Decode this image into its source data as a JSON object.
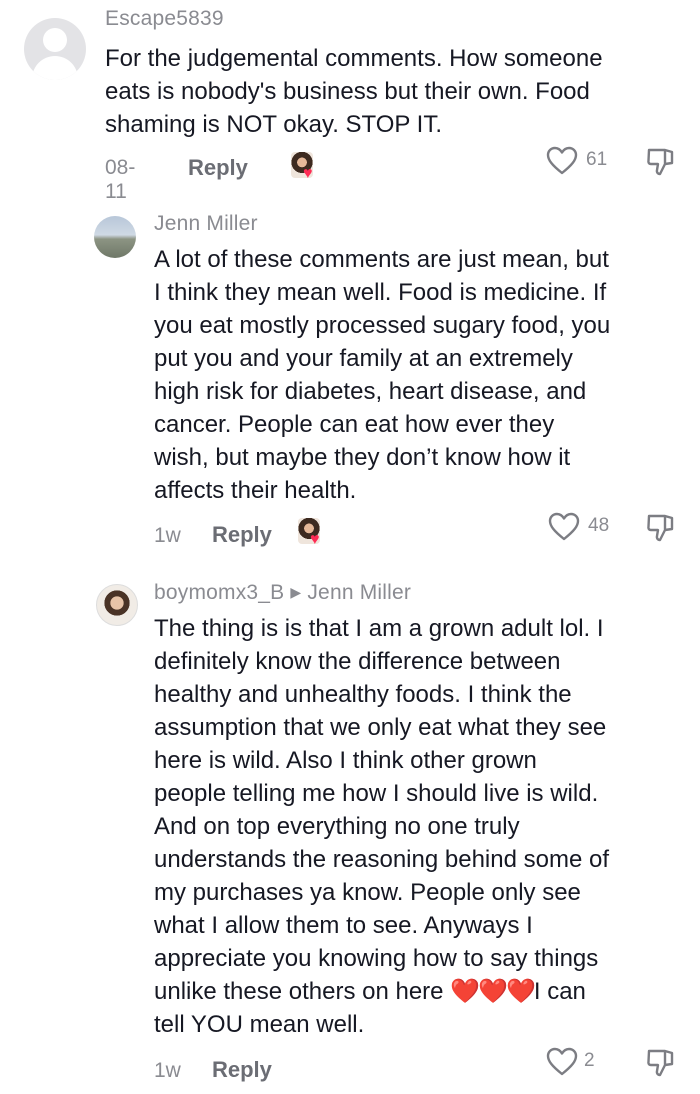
{
  "comments": [
    {
      "username": "Escape5839",
      "lines": [
        "For the judgemental comments. How someone",
        "eats is nobody's business but their own. Food",
        "shaming is NOT okay. STOP IT."
      ],
      "date": "08-11",
      "reply_label": "Reply",
      "likes": "61"
    },
    {
      "username": "Jenn Miller",
      "lines": [
        "A lot of these comments are just mean, but",
        "I think they mean well. Food is medicine. If",
        "you eat mostly processed sugary food, you",
        "put you and your family at an extremely",
        "high risk for diabetes, heart disease, and",
        "cancer. People can eat how ever they",
        "wish, but maybe they don’t know how it",
        "affects their health."
      ],
      "date": "1w",
      "reply_label": "Reply",
      "likes": "48"
    },
    {
      "username": "boymomx3_B",
      "reply_to": "Jenn Miller",
      "lines": [
        "The thing is is that I am a grown adult lol. I",
        "definitely know the difference between",
        "healthy and unhealthy foods. I think the",
        "assumption that we only eat what they see",
        "here is wild. Also I think other grown",
        "people telling me how I should live is wild.",
        "And on top everything no one truly",
        "understands the reasoning behind some of",
        "my purchases ya know. People only see",
        "what I allow them to see. Anyways I",
        "appreciate you knowing how to say things"
      ],
      "line_before_hearts": "unlike these others on here ",
      "hearts": "❤️❤️❤️",
      "line_after_hearts": "I can",
      "last_line": "tell YOU mean well.",
      "date": "1w",
      "reply_label": "Reply",
      "likes": "2"
    }
  ],
  "icons": {
    "like": "heart-outline-icon",
    "dislike": "thumbs-down-icon",
    "creator_liked": "creator-liked-badge"
  },
  "colors": {
    "text": "#161823",
    "muted": "#8a8b91",
    "heart": "#fe2c55"
  }
}
